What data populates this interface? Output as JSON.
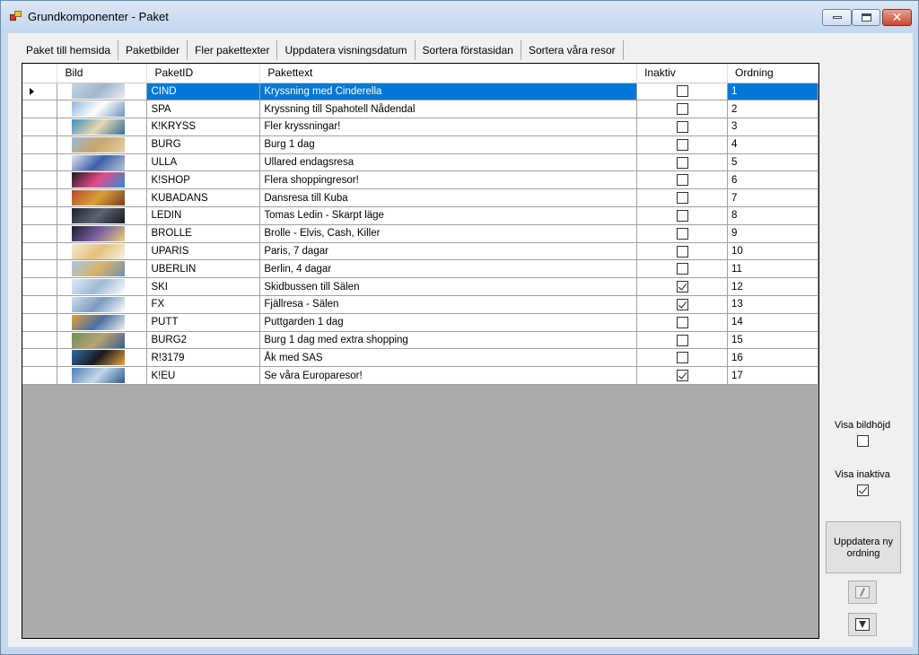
{
  "window": {
    "title": "Grundkomponenter - Paket"
  },
  "tabs": [
    {
      "label": "Paket till hemsida"
    },
    {
      "label": "Paketbilder"
    },
    {
      "label": "Fler pakettexter"
    },
    {
      "label": "Uppdatera visningsdatum"
    },
    {
      "label": "Sortera förstasidan"
    },
    {
      "label": "Sortera våra resor"
    }
  ],
  "grid": {
    "columns": {
      "bild": "Bild",
      "paketid": "PaketID",
      "pakettext": "Pakettext",
      "inaktiv": "Inaktiv",
      "ordning": "Ordning"
    },
    "rows": [
      {
        "id": "CIND",
        "text": "Kryssning med Cinderella",
        "inaktiv": false,
        "ordning": "1",
        "selected": true,
        "img": [
          "#c7d6e4",
          "#9fb6cc",
          "#e9edf1"
        ]
      },
      {
        "id": "SPA",
        "text": "Kryssning till Spahotell Nådendal",
        "inaktiv": false,
        "ordning": "2",
        "img": [
          "#8fb7d8",
          "#ffffff",
          "#6a93b8"
        ]
      },
      {
        "id": "K!KRYSS",
        "text": "Fler kryssningar!",
        "inaktiv": false,
        "ordning": "3",
        "img": [
          "#3a8fbf",
          "#e7d8b0",
          "#2f6f9c"
        ]
      },
      {
        "id": "BURG",
        "text": "Burg 1 dag",
        "inaktiv": false,
        "ordning": "4",
        "img": [
          "#9bb8d6",
          "#c9a66b",
          "#e4d3a8"
        ]
      },
      {
        "id": "ULLA",
        "text": "Ullared endagsresa",
        "inaktiv": false,
        "ordning": "5",
        "img": [
          "#e1e6ee",
          "#3b5fa5",
          "#b9c6d8"
        ]
      },
      {
        "id": "K!SHOP",
        "text": "Flera shoppingresor!",
        "inaktiv": false,
        "ordning": "6",
        "img": [
          "#1b1b1b",
          "#e44a8b",
          "#2a8fd3"
        ]
      },
      {
        "id": "KUBADANS",
        "text": "Dansresa till Kuba",
        "inaktiv": false,
        "ordning": "7",
        "img": [
          "#b9472e",
          "#d9a036",
          "#7a3a22"
        ]
      },
      {
        "id": "LEDIN",
        "text": "Tomas Ledin - Skarpt läge",
        "inaktiv": false,
        "ordning": "8",
        "img": [
          "#20242c",
          "#5c6374",
          "#15181e"
        ]
      },
      {
        "id": "BROLLE",
        "text": "Brolle - Elvis, Cash, Killer",
        "inaktiv": false,
        "ordning": "9",
        "img": [
          "#1b1b2e",
          "#7a5fa2",
          "#e9d27a"
        ]
      },
      {
        "id": "UPARIS",
        "text": "Paris, 7 dagar",
        "inaktiv": false,
        "ordning": "10",
        "img": [
          "#f2e9d6",
          "#e6c27a",
          "#f7f2e6"
        ]
      },
      {
        "id": "UBERLIN",
        "text": "Berlin, 4 dagar",
        "inaktiv": false,
        "ordning": "11",
        "img": [
          "#a9c6e6",
          "#d7b36a",
          "#6f8fb3"
        ]
      },
      {
        "id": "SKI",
        "text": "Skidbussen till Sälen",
        "inaktiv": true,
        "ordning": "12",
        "img": [
          "#dfe9f4",
          "#9fb9d6",
          "#ffffff"
        ]
      },
      {
        "id": "FX",
        "text": "Fjällresa - Sälen",
        "inaktiv": true,
        "ordning": "13",
        "img": [
          "#cfdcea",
          "#7b9bc0",
          "#ffffff"
        ]
      },
      {
        "id": "PUTT",
        "text": "Puttgarden 1 dag",
        "inaktiv": false,
        "ordning": "14",
        "img": [
          "#e5a23a",
          "#4a6fa0",
          "#f1f1f1"
        ]
      },
      {
        "id": "BURG2",
        "text": "Burg 1 dag med extra shopping",
        "inaktiv": false,
        "ordning": "15",
        "img": [
          "#6e8f5a",
          "#b7a274",
          "#3c5d8a"
        ]
      },
      {
        "id": "R!3179",
        "text": "Åk med SAS",
        "inaktiv": false,
        "ordning": "16",
        "img": [
          "#2c6fb0",
          "#1a1a1a",
          "#e7a640"
        ]
      },
      {
        "id": "K!EU",
        "text": "Se våra Europaresor!",
        "inaktiv": true,
        "ordning": "17",
        "img": [
          "#4b7fb8",
          "#c4d8ea",
          "#2e5a8c"
        ]
      }
    ]
  },
  "side": {
    "visa_bildhojd_label": "Visa bildhöjd",
    "visa_bildhojd": false,
    "visa_inaktiva_label": "Visa inaktiva",
    "visa_inaktiva": true,
    "update_button_label": "Uppdatera ny ordning"
  },
  "icons": {
    "edit": "edit-icon",
    "filter": "filter-icon"
  }
}
